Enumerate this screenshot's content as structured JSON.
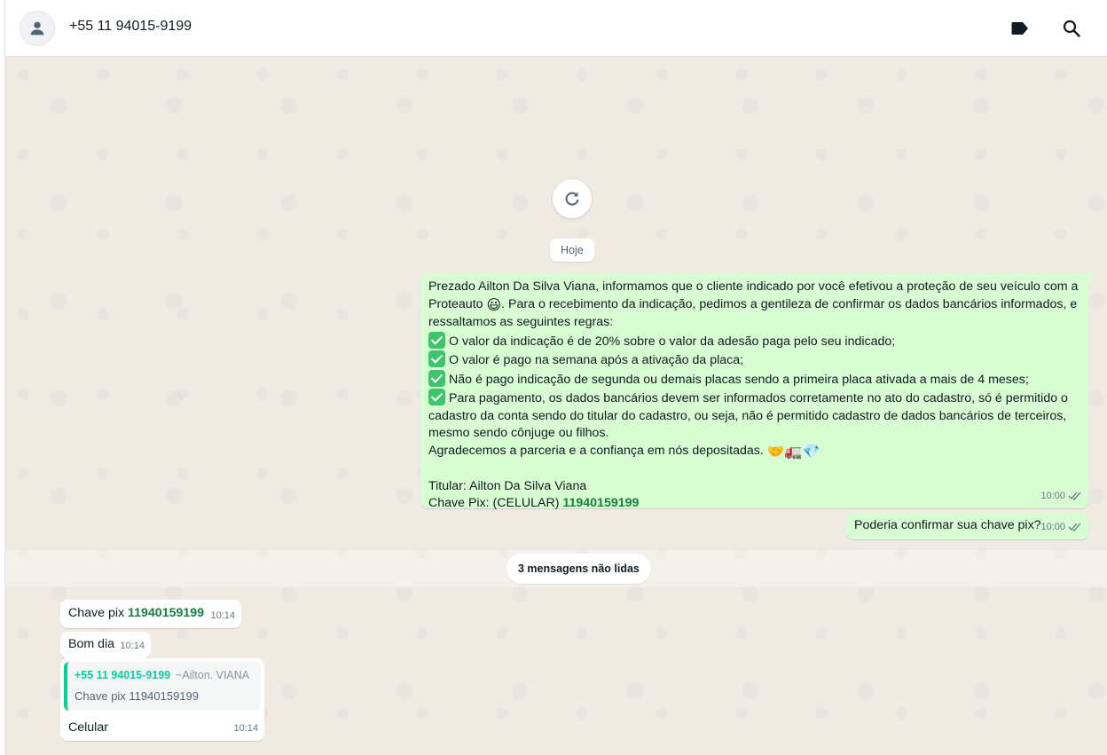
{
  "header": {
    "contact_name": "+55 11 94015-9199",
    "icons": [
      "avatar-person-icon",
      "label-icon",
      "search-icon"
    ]
  },
  "chat": {
    "date_chip": "Hoje",
    "messages": {
      "main": {
        "intro_1": "Prezado Ailton Da Silva Viana, informamos que o cliente indicado por você efetivou a proteção de seu veículo com a Proteauto",
        "intro_emoji": "😃",
        "intro_2": ". Para o recebimento da indicação, pedimos a gentileza de confirmar os dados bancários informados, e ressaltamos as seguintes regras:",
        "rules": [
          "O valor da indicação é de 20% sobre o valor da adesão paga pelo seu indicado;",
          "O valor é pago na semana após a ativação da placa;",
          "Não é pago indicação de segunda ou demais placas sendo a primeira placa ativada a mais de 4 meses;",
          "Para pagamento, os dados bancários devem ser informados corretamente no ato do cadastro, só é permitido o cadastro da conta sendo do titular do cadastro, ou seja, não é permitido cadastro de dados bancários de terceiros, mesmo sendo cônjuge ou filhos."
        ],
        "thanks": "Agradecemos a parceria e a confiança em nós depositadas.",
        "thanks_emojis": "🤝🚛💎",
        "titular": "Titular: Ailton Da Silva Viana",
        "pix_prefix": "Chave Pix: (CELULAR) ",
        "pix_number": "11940159199",
        "time": "10:00"
      },
      "confirm": {
        "text": "Poderia confirmar sua chave pix?",
        "time": "10:00"
      },
      "unread": "3 mensagens não lidas",
      "pix_reply": {
        "prefix": "Chave pix ",
        "number": "11940159199",
        "time": "10:14"
      },
      "bom_dia": {
        "text": "Bom dia",
        "time": "10:14"
      },
      "quoted_reply": {
        "quote_author": "+55 11 94015-9199",
        "quote_name": "~Ailton. VIANA",
        "quote_text": "Chave pix 11940159199",
        "text": "Celular",
        "time": "10:14"
      }
    }
  },
  "colors": {
    "outgoing_bubble": "#d9fdd3",
    "incoming_bubble": "#ffffff",
    "chat_background": "#efeae2",
    "accent_green": "#06cf9c",
    "pix_green": "#15803d"
  }
}
